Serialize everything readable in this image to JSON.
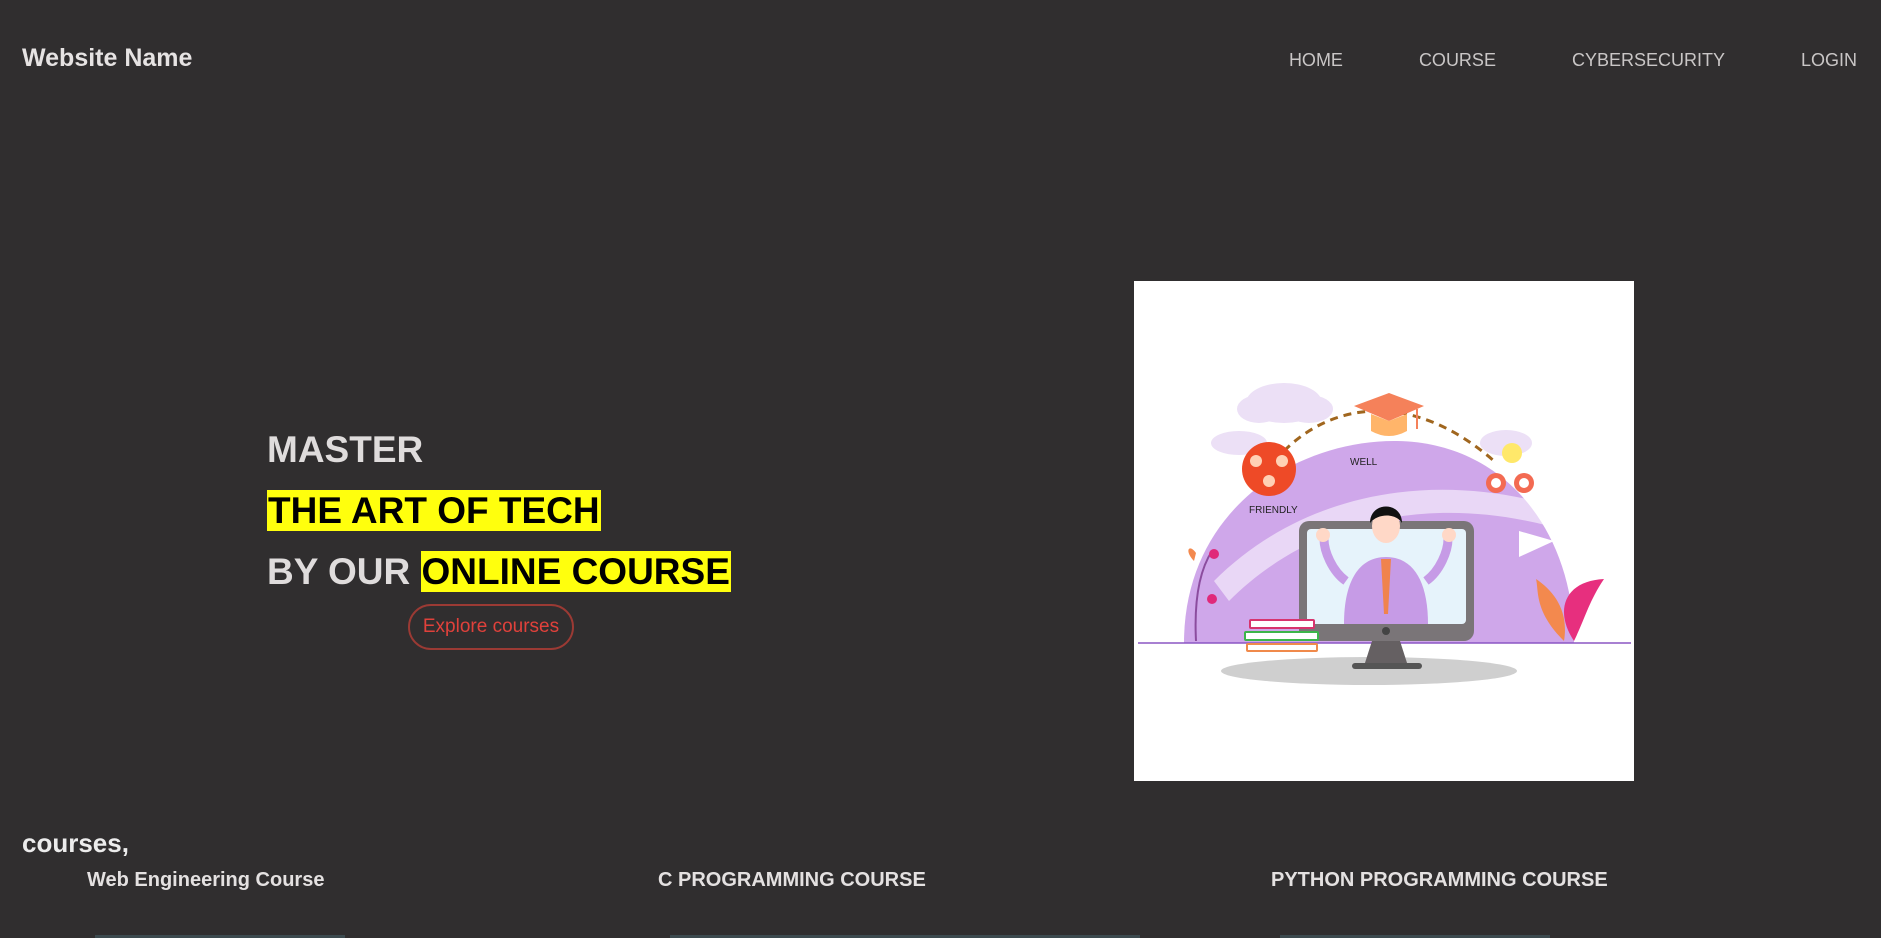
{
  "header": {
    "brand": "Website Name",
    "nav": [
      "HOME",
      "COURSE",
      "CYBERSECURITY",
      "LOGIN"
    ]
  },
  "hero": {
    "line1": "MASTER",
    "line2": "THE ART OF TECH",
    "line3_prefix": "BY OUR",
    "line3_highlight": "ONLINE COURSE",
    "cta": "Explore courses",
    "highlight_color": "#ffff0d",
    "cta_color": "#e0413b"
  },
  "illustration": {
    "label_well": "WELL",
    "label_friendly": "FRIENDLY"
  },
  "courses": {
    "heading": "courses,",
    "items": [
      "Web Engineering Course",
      "C PROGRAMMING COURSE",
      "PYTHON PROGRAMMING COURSE"
    ]
  },
  "colors": {
    "background": "#302e2f",
    "illustration_accent": "#c9a4e8"
  }
}
